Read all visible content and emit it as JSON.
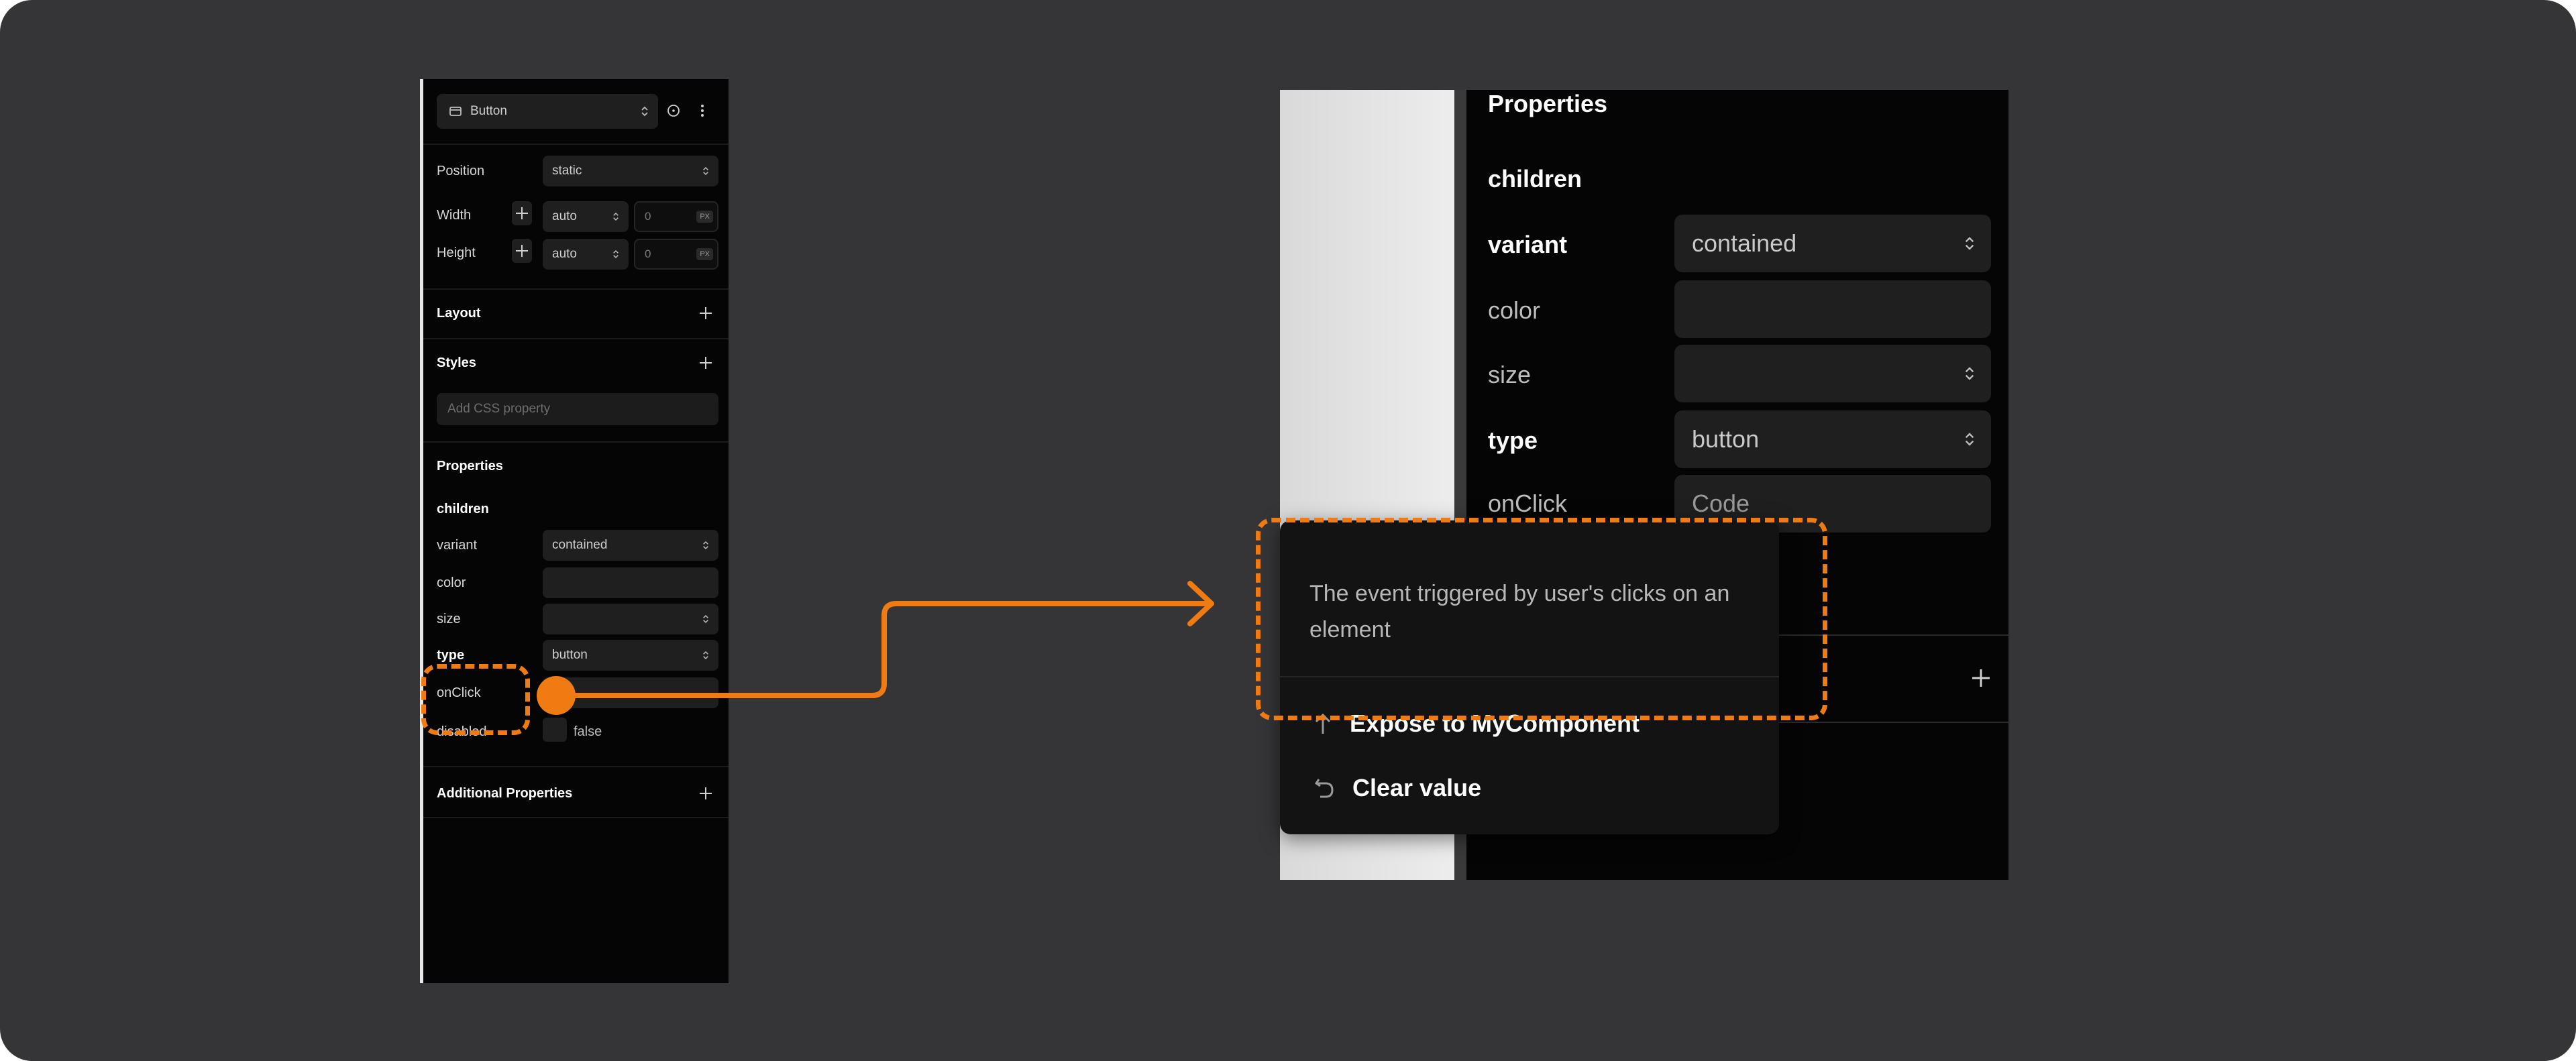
{
  "left_panel": {
    "component_select": {
      "value": "Button",
      "icon": "component-icon"
    },
    "toolbar_icons": [
      "info-icon",
      "more-vertical-icon"
    ],
    "layout_rows": [
      {
        "label": "Position",
        "value": "static"
      },
      {
        "label": "Width",
        "mode": "auto",
        "number": "0",
        "unit": "PX"
      },
      {
        "label": "Height",
        "mode": "auto",
        "number": "0",
        "unit": "PX"
      }
    ],
    "sections": {
      "layout": "Layout",
      "styles": "Styles",
      "properties": "Properties",
      "additional": "Additional Properties"
    },
    "styles_search_placeholder": "Add CSS property",
    "properties": {
      "children": "children",
      "variant": {
        "label": "variant",
        "value": "contained"
      },
      "color": {
        "label": "color",
        "value": ""
      },
      "size": {
        "label": "size",
        "value": ""
      },
      "type": {
        "label": "type",
        "value": "button"
      },
      "onClick": {
        "label": "onClick"
      },
      "disabled": {
        "label": "disabled",
        "value": "false"
      }
    }
  },
  "zoom_panel": {
    "title": "Properties",
    "children": "children",
    "variant": {
      "label": "variant",
      "value": "contained"
    },
    "color": {
      "label": "color",
      "value": ""
    },
    "size": {
      "label": "size",
      "value": ""
    },
    "type": {
      "label": "type",
      "value": "button"
    },
    "onClick": {
      "label": "onClick",
      "placeholder": "Code"
    }
  },
  "tooltip": {
    "description": "The event triggered by user's clicks on an element",
    "actions": [
      {
        "icon": "arrow-up-icon",
        "label": "Expose to MyComponent"
      },
      {
        "icon": "undo-icon",
        "label": "Clear value"
      }
    ]
  },
  "colors": {
    "accent": "#f07b12",
    "background": "#353537",
    "panel": "#050505"
  }
}
